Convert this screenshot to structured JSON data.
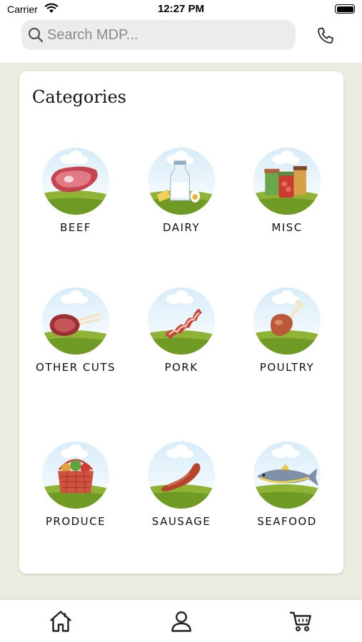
{
  "status_bar": {
    "carrier": "Carrier",
    "time": "12:27 PM"
  },
  "search": {
    "placeholder": "Search MDP..."
  },
  "card": {
    "title": "Categories",
    "categories": [
      {
        "label": "BEEF",
        "icon": "beef-steak-icon"
      },
      {
        "label": "DAIRY",
        "icon": "milk-bottle-icon"
      },
      {
        "label": "MISC",
        "icon": "jars-icon"
      },
      {
        "label": "OTHER CUTS",
        "icon": "rack-of-lamb-icon"
      },
      {
        "label": "PORK",
        "icon": "bacon-icon"
      },
      {
        "label": "POULTRY",
        "icon": "chicken-leg-icon"
      },
      {
        "label": "PRODUCE",
        "icon": "vegetable-basket-icon"
      },
      {
        "label": "SAUSAGE",
        "icon": "sausage-icon"
      },
      {
        "label": "SEAFOOD",
        "icon": "fish-icon"
      }
    ]
  },
  "tab_bar": {
    "tabs": [
      "home-icon",
      "profile-icon",
      "cart-icon"
    ]
  }
}
